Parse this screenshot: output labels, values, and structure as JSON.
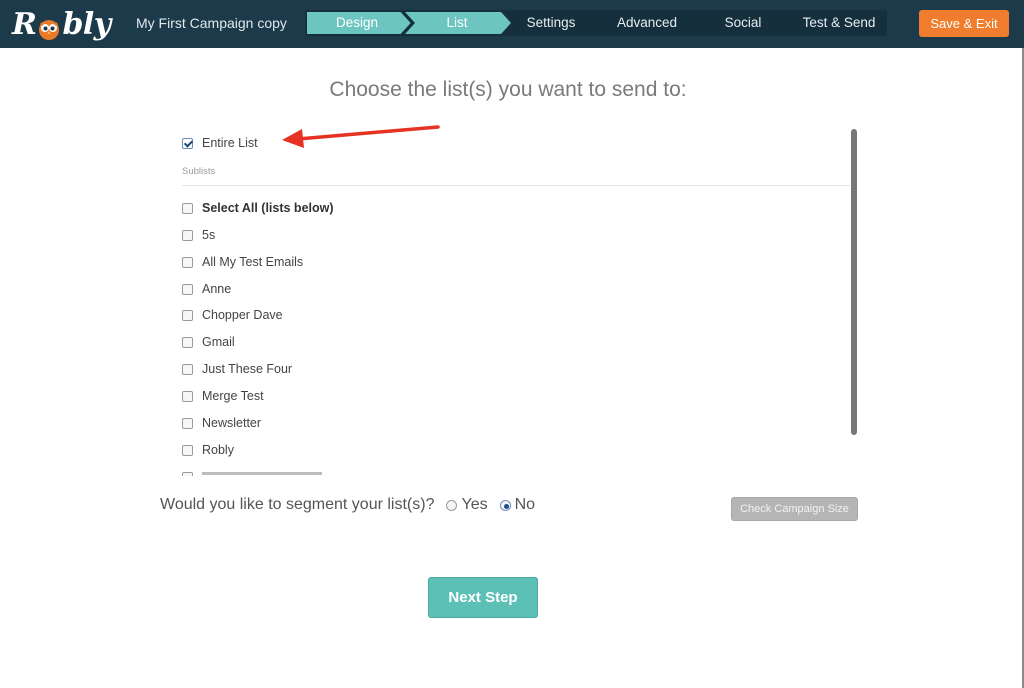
{
  "app": {
    "brand": "Robly",
    "campaign_title": "My First Campaign copy",
    "save_exit_label": "Save & Exit"
  },
  "steps": [
    {
      "label": "Design",
      "state": "done"
    },
    {
      "label": "List",
      "state": "active"
    },
    {
      "label": "Settings",
      "state": "pending"
    },
    {
      "label": "Advanced",
      "state": "pending"
    },
    {
      "label": "Social",
      "state": "pending"
    },
    {
      "label": "Test & Send",
      "state": "pending"
    }
  ],
  "main": {
    "heading": "Choose the list(s) you want to send to:",
    "entire_list": {
      "label": "Entire List",
      "checked": true
    },
    "sublists_label": "Sublists",
    "select_all": {
      "label": "Select All (lists below)",
      "checked": false
    },
    "lists": [
      {
        "label": "5s",
        "checked": false
      },
      {
        "label": "All My Test Emails",
        "checked": false
      },
      {
        "label": "Anne",
        "checked": false
      },
      {
        "label": "Chopper Dave",
        "checked": false
      },
      {
        "label": "Gmail",
        "checked": false
      },
      {
        "label": "Just These Four",
        "checked": false
      },
      {
        "label": "Merge Test",
        "checked": false
      },
      {
        "label": "Newsletter",
        "checked": false
      },
      {
        "label": "Robly",
        "checked": false
      }
    ],
    "segment": {
      "question": "Would you like to segment your list(s)?",
      "options": [
        {
          "label": "Yes",
          "selected": false
        },
        {
          "label": "No",
          "selected": true
        }
      ]
    },
    "check_size_label": "Check Campaign Size",
    "next_step_label": "Next Step"
  },
  "colors": {
    "topbar": "#1c3a4a",
    "step_active": "#6cc5c0",
    "save_button": "#ef7d2d",
    "next_button": "#5cc0b7",
    "annotation_arrow": "#e63222"
  },
  "icons": {
    "logo_owl": "owl-icon",
    "annotation": "red-arrow-icon"
  }
}
